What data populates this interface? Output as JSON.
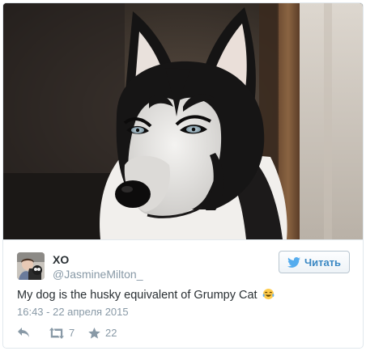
{
  "tweet": {
    "author_name": "XO",
    "author_handle": "@JasmineMilton_",
    "follow_label": "Читать",
    "text": "My dog is the husky equivalent of Grumpy Cat",
    "timestamp": "16:43 - 22 апреля 2015",
    "retweet_count": "7",
    "like_count": "22",
    "emoji": "tears-of-joy-emoji"
  },
  "icons": {
    "follow": "twitter-bird-icon",
    "reply": "reply-arrow-icon",
    "retweet": "retweet-icon",
    "like": "star-icon"
  },
  "colors": {
    "accent": "#3b88c3",
    "text": "#292f33",
    "muted": "#8899a6",
    "border": "#e1e8ed"
  }
}
